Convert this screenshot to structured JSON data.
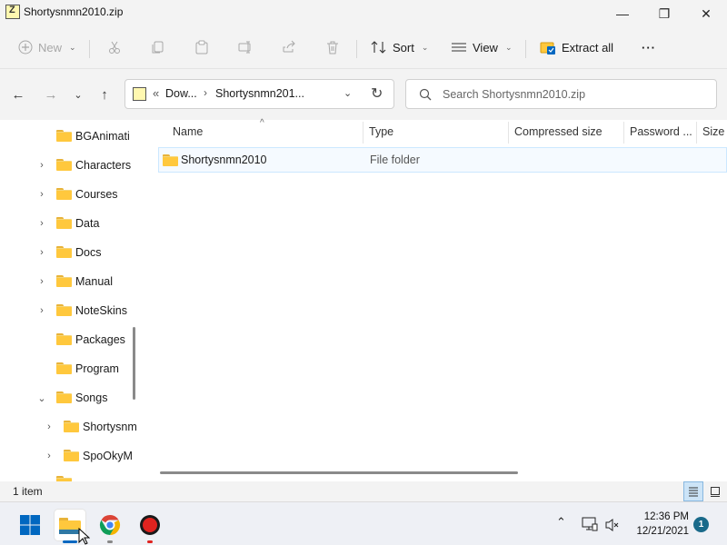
{
  "window": {
    "title": "Shortysnmn2010.zip"
  },
  "titlebar": {
    "minimize": "—",
    "maximize": "❐",
    "close": "✕"
  },
  "commandbar": {
    "new_label": "New",
    "sort_label": "Sort",
    "view_label": "View",
    "extract_label": "Extract all",
    "more_label": "···"
  },
  "address": {
    "overflow": "«",
    "crumbs": [
      "Dow...",
      "Shortysnmn201..."
    ],
    "separator": "›"
  },
  "search": {
    "placeholder": "Search Shortysnmn2010.zip"
  },
  "nav": {
    "items": [
      {
        "label": "BGAnimati",
        "chevron": ""
      },
      {
        "label": "Characters",
        "chevron": "›"
      },
      {
        "label": "Courses",
        "chevron": "›"
      },
      {
        "label": "Data",
        "chevron": "›"
      },
      {
        "label": "Docs",
        "chevron": "›"
      },
      {
        "label": "Manual",
        "chevron": "›"
      },
      {
        "label": "NoteSkins",
        "chevron": "›"
      },
      {
        "label": "Packages",
        "chevron": ""
      },
      {
        "label": "Program",
        "chevron": ""
      },
      {
        "label": "Songs",
        "chevron": "⌄"
      },
      {
        "label": "Shortysnm",
        "chevron": "›"
      },
      {
        "label": "SpoOkyM",
        "chevron": "›"
      }
    ]
  },
  "columns": {
    "name": "Name",
    "type": "Type",
    "compressed": "Compressed size",
    "password": "Password ...",
    "size": "Size"
  },
  "files": [
    {
      "name": "Shortysnmn2010",
      "type": "File folder"
    }
  ],
  "status": {
    "count": "1 item"
  },
  "taskbar": {
    "time": "12:36 PM",
    "date": "12/21/2021",
    "notifications": "1"
  },
  "colors": {
    "accent": "#0067c0",
    "folder": "#ffc83d",
    "chrome_red": "#db4437",
    "chrome_yellow": "#f4b400",
    "chrome_green": "#0f9d58",
    "chrome_blue": "#4285f4"
  }
}
